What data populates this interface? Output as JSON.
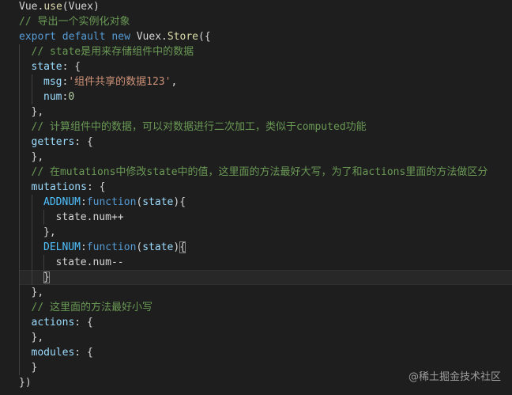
{
  "editor": {
    "lines": [
      {
        "tokens": [
          [
            "Vue",
            "var"
          ],
          [
            ".",
            "punc"
          ],
          [
            "use",
            "fn"
          ],
          [
            "(",
            "punc"
          ],
          [
            "Vuex",
            "var"
          ],
          [
            ")",
            "punc"
          ]
        ]
      },
      {
        "tokens": [
          [
            "// 导出一个实例化对象",
            "cmt"
          ]
        ]
      },
      {
        "tokens": [
          [
            "export",
            "kw"
          ],
          [
            " ",
            "punc"
          ],
          [
            "default",
            "kw"
          ],
          [
            " ",
            "punc"
          ],
          [
            "new",
            "kw"
          ],
          [
            " ",
            "punc"
          ],
          [
            "Vuex",
            "var"
          ],
          [
            ".",
            "punc"
          ],
          [
            "Store",
            "fn"
          ],
          [
            "({",
            "punc"
          ]
        ]
      },
      {
        "tokens": [
          [
            "// state是用来存储组件中的数据",
            "cmt"
          ]
        ]
      },
      {
        "tokens": [
          [
            "state",
            "prop"
          ],
          [
            ": {",
            "punc"
          ]
        ]
      },
      {
        "tokens": [
          [
            "msg",
            "prop"
          ],
          [
            ":",
            "punc"
          ],
          [
            "'组件共享的数据123'",
            "str"
          ],
          [
            ",",
            "punc"
          ]
        ]
      },
      {
        "tokens": [
          [
            "num",
            "prop"
          ],
          [
            ":",
            "punc"
          ],
          [
            "0",
            "num"
          ]
        ]
      },
      {
        "tokens": [
          [
            "},",
            "punc"
          ]
        ]
      },
      {
        "tokens": [
          [
            "// 计算组件中的数据，可以对数据进行二次加工，类似于computed功能",
            "cmt"
          ]
        ]
      },
      {
        "tokens": [
          [
            "getters",
            "prop"
          ],
          [
            ": {",
            "punc"
          ]
        ]
      },
      {
        "tokens": [
          [
            "},",
            "punc"
          ]
        ]
      },
      {
        "tokens": [
          [
            "// 在mutations中修改state中的值，这里面的方法最好大写，为了和actions里面的方法做区分",
            "cmt"
          ]
        ]
      },
      {
        "tokens": [
          [
            "mutations",
            "prop"
          ],
          [
            ": {",
            "punc"
          ]
        ]
      },
      {
        "tokens": [
          [
            "ADDNUM",
            "constant"
          ],
          [
            ":",
            "punc"
          ],
          [
            "function",
            "kw"
          ],
          [
            "(",
            "punc"
          ],
          [
            "state",
            "prop"
          ],
          [
            "){",
            "punc"
          ]
        ]
      },
      {
        "tokens": [
          [
            "state",
            "var"
          ],
          [
            ".",
            "punc"
          ],
          [
            "num",
            "var"
          ],
          [
            "++",
            "op"
          ]
        ]
      },
      {
        "tokens": [
          [
            "},",
            "punc"
          ]
        ]
      },
      {
        "tokens": [
          [
            "DELNUM",
            "constant"
          ],
          [
            ":",
            "punc"
          ],
          [
            "function",
            "kw"
          ],
          [
            "(",
            "punc"
          ],
          [
            "state",
            "prop"
          ],
          [
            ")",
            "punc"
          ],
          [
            "{",
            "punc"
          ]
        ]
      },
      {
        "tokens": [
          [
            "state",
            "var"
          ],
          [
            ".",
            "punc"
          ],
          [
            "num",
            "var"
          ],
          [
            "--",
            "op"
          ]
        ]
      },
      {
        "tokens": [
          [
            "}",
            "punc"
          ]
        ]
      },
      {
        "tokens": [
          [
            "},",
            "punc"
          ]
        ]
      },
      {
        "tokens": [
          [
            "// 这里面的方法最好小写",
            "cmt"
          ]
        ]
      },
      {
        "tokens": [
          [
            "actions",
            "prop"
          ],
          [
            ": {",
            "punc"
          ]
        ]
      },
      {
        "tokens": [
          [
            "},",
            "punc"
          ]
        ]
      },
      {
        "tokens": [
          [
            "modules",
            "prop"
          ],
          [
            ": {",
            "punc"
          ]
        ]
      },
      {
        "tokens": [
          [
            "}",
            "punc"
          ]
        ]
      },
      {
        "tokens": [
          [
            "})",
            "punc"
          ]
        ]
      }
    ]
  },
  "colors": {
    "background": "#1e1e1e",
    "keyword": "#569cd6",
    "function": "#dcdcaa",
    "string": "#ce9178",
    "number": "#b5cea8",
    "comment": "#6a9955",
    "property": "#9cdcfe",
    "constant": "#4fc1ff"
  },
  "watermark": "@稀土掘金技术社区"
}
